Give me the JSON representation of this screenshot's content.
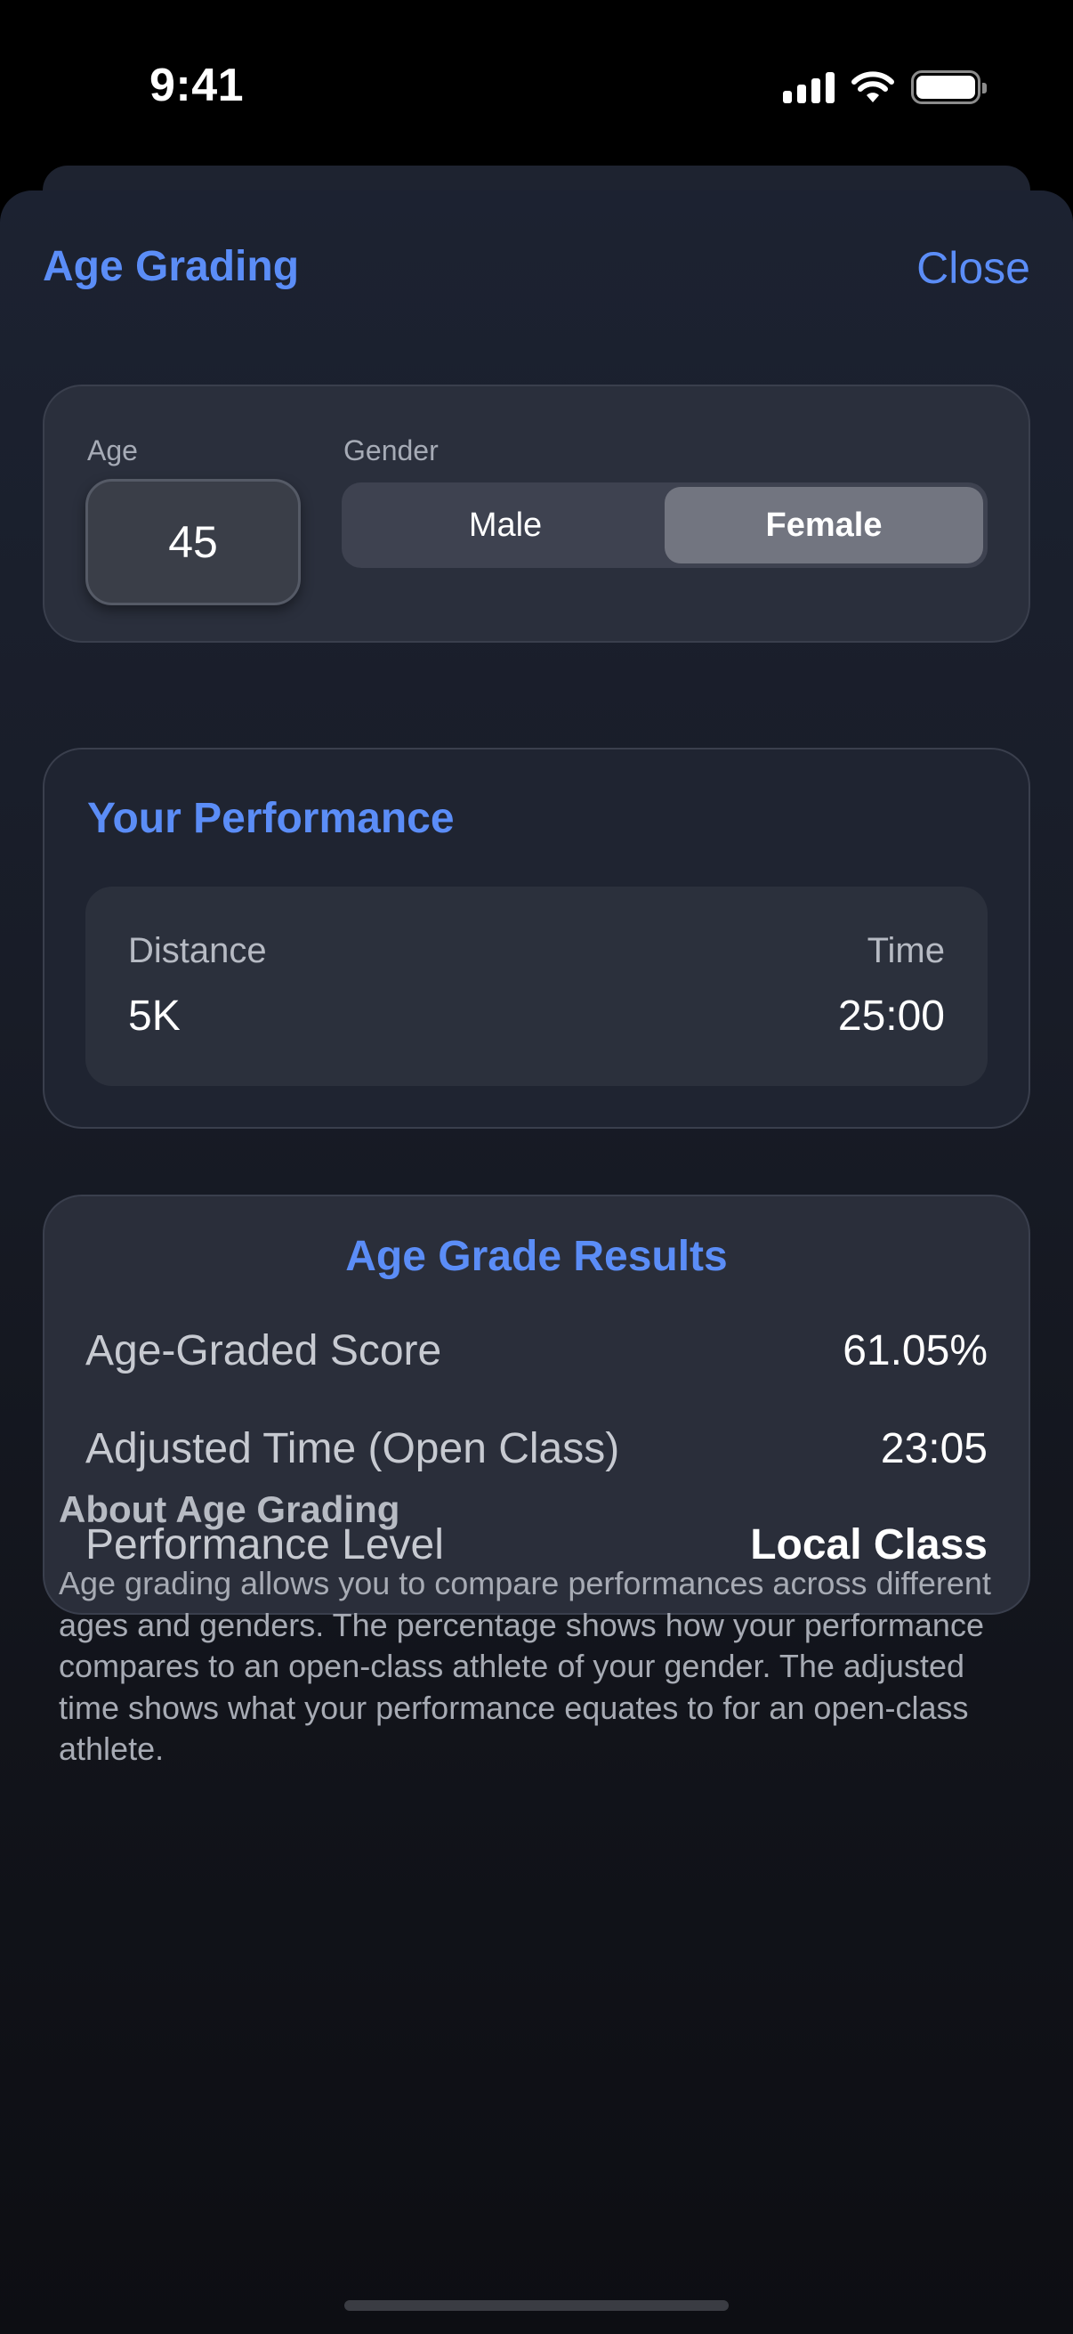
{
  "status_bar": {
    "time": "9:41"
  },
  "nav": {
    "title": "Age Grading",
    "close_label": "Close"
  },
  "inputs": {
    "age_label": "Age",
    "age_value": "45",
    "gender_label": "Gender",
    "gender_options": [
      "Male",
      "Female"
    ],
    "gender_selected": "Female"
  },
  "performance": {
    "title": "Your Performance",
    "distance_label": "Distance",
    "distance_value": "5K",
    "time_label": "Time",
    "time_value": "25:00"
  },
  "results": {
    "title": "Age Grade Results",
    "rows": [
      {
        "label": "Age-Graded Score",
        "value": "61.05%"
      },
      {
        "label": "Adjusted Time (Open Class)",
        "value": "23:05"
      },
      {
        "label": "Performance Level",
        "value": "Local Class"
      }
    ]
  },
  "about": {
    "title": "About Age Grading",
    "text": "Age grading allows you to compare performances across different ages and genders. The percentage shows how your performance compares to an open-class athlete of your gender. The adjusted time shows what your performance equates to for an open-class athlete."
  },
  "colors": {
    "accent": "#5b8df7",
    "background": "#000000",
    "card": "#262b38"
  }
}
